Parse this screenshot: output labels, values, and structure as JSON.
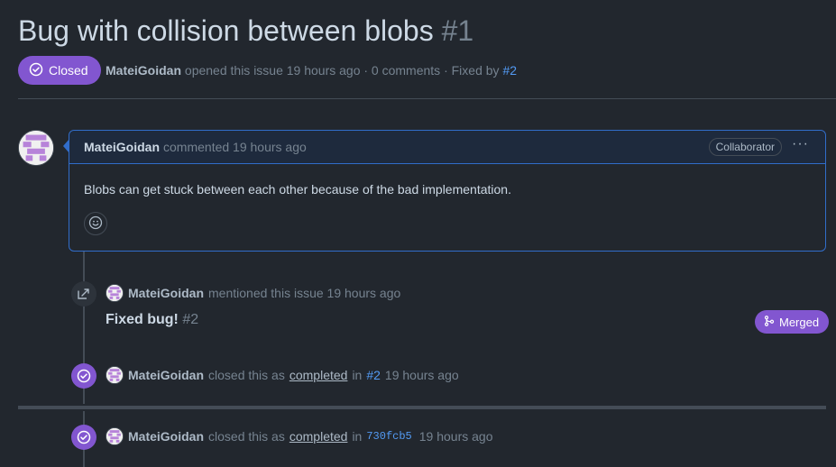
{
  "issue": {
    "title": "Bug with collision between blobs",
    "number": "#1",
    "state": "Closed",
    "author": "MateiGoidan",
    "opened_text": "opened this issue 19 hours ago · 0 comments · Fixed by",
    "fixed_by_ref": "#2"
  },
  "comment": {
    "author": "MateiGoidan",
    "meta": "commented 19 hours ago",
    "role_badge": "Collaborator",
    "menu_glyph": "···",
    "body": "Blobs can get stuck between each other because of the bad implementation."
  },
  "events": {
    "mention": {
      "author": "MateiGoidan",
      "text": "mentioned this issue 19 hours ago",
      "ref_title": "Fixed bug!",
      "ref_number": "#2",
      "ref_state": "Merged"
    },
    "closed_pr": {
      "author": "MateiGoidan",
      "text_before": "closed this as",
      "reason": "completed",
      "text_in": "in",
      "ref": "#2",
      "time": "19 hours ago"
    },
    "closed_commit": {
      "author": "MateiGoidan",
      "text_before": "closed this as",
      "reason": "completed",
      "text_in": "in",
      "commit": "730fcb5",
      "time": "19 hours ago"
    }
  },
  "colors": {
    "background": "#22272e",
    "accent_purple": "#8256d0",
    "link_blue": "#539bf5",
    "comment_border": "#316dca"
  }
}
